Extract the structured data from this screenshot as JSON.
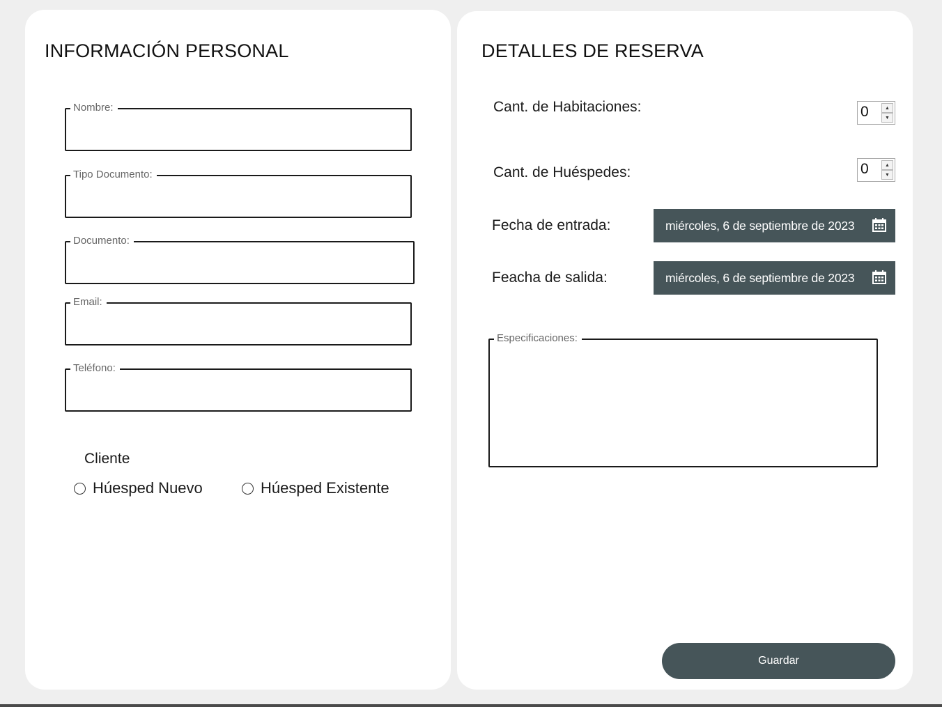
{
  "left_panel": {
    "title": "INFORMACIÓN PERSONAL",
    "fields": [
      {
        "label": "Nombre:",
        "value": ""
      },
      {
        "label": "Tipo Documento:",
        "value": ""
      },
      {
        "label": "Documento:",
        "value": ""
      },
      {
        "label": "Email:",
        "value": ""
      },
      {
        "label": "Teléfono:",
        "value": ""
      }
    ],
    "client_label": "Cliente",
    "radio_options": [
      {
        "label": "Húesped Nuevo",
        "checked": false
      },
      {
        "label": "Húesped Existente",
        "checked": false
      }
    ]
  },
  "right_panel": {
    "title": "DETALLES DE RESERVA",
    "rooms_label": "Cant. de Habitaciones:",
    "rooms_value": "0",
    "guests_label": "Cant. de Huéspedes:",
    "guests_value": "0",
    "checkin_label": "Fecha de entrada:",
    "checkin_value": "miércoles, 6 de septiembre de 2023",
    "checkout_label": "Feacha de salida:",
    "checkout_value": "miércoles, 6 de septiembre de 2023",
    "specs_label": "Especificaciones:",
    "specs_value": "",
    "save_label": "Guardar"
  },
  "colors": {
    "accent": "#465559",
    "panel_bg": "#ffffff",
    "window_bg": "#efefef"
  },
  "icons": {
    "date_picker": "calendar-icon",
    "spinner_up": "arrow-up-icon",
    "spinner_down": "arrow-down-icon"
  }
}
